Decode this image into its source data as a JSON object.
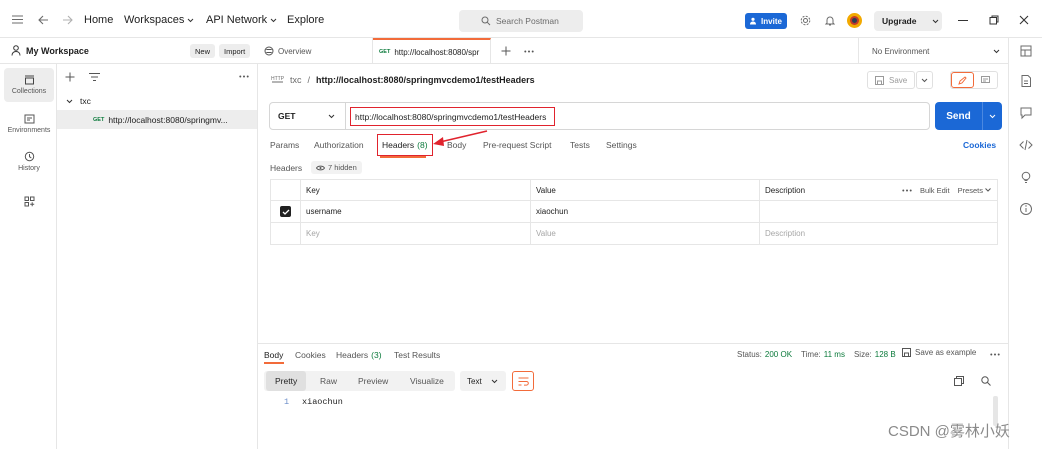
{
  "topbar": {
    "nav": [
      "Home",
      "Workspaces",
      "API Network",
      "Explore"
    ],
    "search_placeholder": "Search Postman",
    "invite_label": "Invite",
    "upgrade_label": "Upgrade"
  },
  "workspace": {
    "name": "My Workspace",
    "new_label": "New",
    "import_label": "Import"
  },
  "rail": {
    "items": [
      {
        "label": "Collections",
        "icon": "collections-icon"
      },
      {
        "label": "Environments",
        "icon": "environments-icon"
      },
      {
        "label": "History",
        "icon": "history-icon"
      },
      {
        "label": "",
        "icon": "add-apps-icon"
      }
    ]
  },
  "tree": {
    "collection": "txc",
    "request_method": "GET",
    "request_label": "http://localhost:8080/springmv..."
  },
  "tabs": {
    "overview": "Overview",
    "active_method": "GET",
    "active_label": "http://localhost:8080/spr",
    "environment": "No Environment"
  },
  "request": {
    "breadcrumb_parent": "txc",
    "breadcrumb_sep": "/",
    "title": "http://localhost:8080/springmvcdemo1/testHeaders",
    "save_label": "Save",
    "method": "GET",
    "url": "http://localhost:8080/springmvcdemo1/testHeaders",
    "send_label": "Send",
    "tabs": [
      "Params",
      "Authorization",
      "Headers",
      "(8)",
      "Body",
      "Pre-request Script",
      "Tests",
      "Settings"
    ],
    "cookies_label": "Cookies",
    "headers_label": "Headers",
    "hidden_label": "7 hidden"
  },
  "headers_table": {
    "columns": [
      "Key",
      "Value",
      "Description"
    ],
    "bulk_edit": "Bulk Edit",
    "presets": "Presets",
    "rows": [
      {
        "key": "username",
        "value": "xiaochun",
        "description": "",
        "checked": true
      }
    ],
    "placeholders": {
      "key": "Key",
      "value": "Value",
      "description": "Description"
    }
  },
  "response": {
    "tabs": [
      "Body",
      "Cookies",
      "Headers",
      "(3)",
      "Test Results"
    ],
    "status_label": "Status:",
    "status_value": "200 OK",
    "time_label": "Time:",
    "time_value": "11 ms",
    "size_label": "Size:",
    "size_value": "128 B",
    "save_example": "Save as example",
    "view_modes": [
      "Pretty",
      "Raw",
      "Preview",
      "Visualize"
    ],
    "format": "Text",
    "line_number": "1",
    "body_text": "xiaochun"
  },
  "watermark": "CSDN @雾林小妖",
  "colors": {
    "accent_blue": "#1b68d6",
    "highlight_red": "#e0232d",
    "status_green": "#0b7a3b",
    "cookies_link": "#1b68d6"
  }
}
